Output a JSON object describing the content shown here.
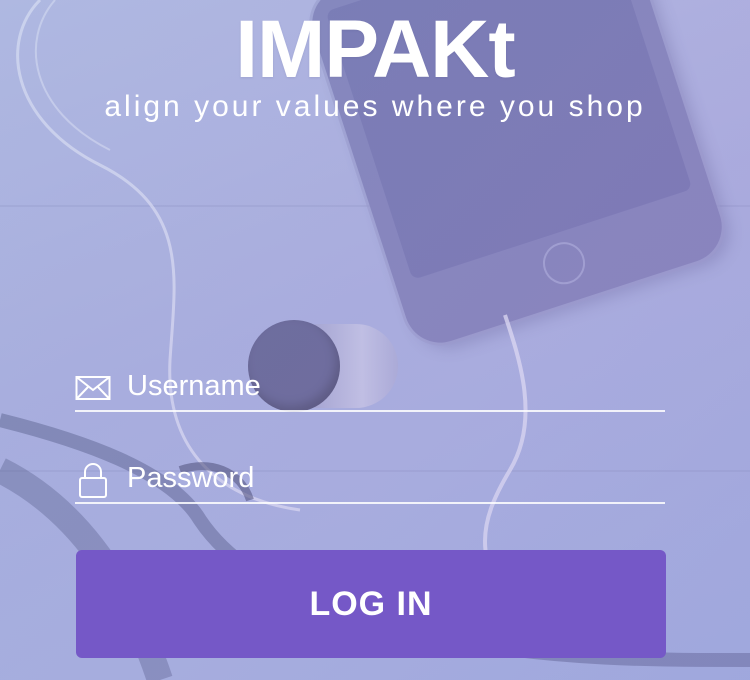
{
  "header": {
    "title": "IMPAKt",
    "tagline": "align your values where you shop"
  },
  "login_form": {
    "username": {
      "placeholder": "Username",
      "value": "",
      "icon": "envelope-icon"
    },
    "password": {
      "placeholder": "Password",
      "value": "",
      "icon": "lock-icon"
    },
    "submit_label": "LOG IN"
  },
  "colors": {
    "accent": "#7558c7",
    "text": "#ffffff"
  }
}
